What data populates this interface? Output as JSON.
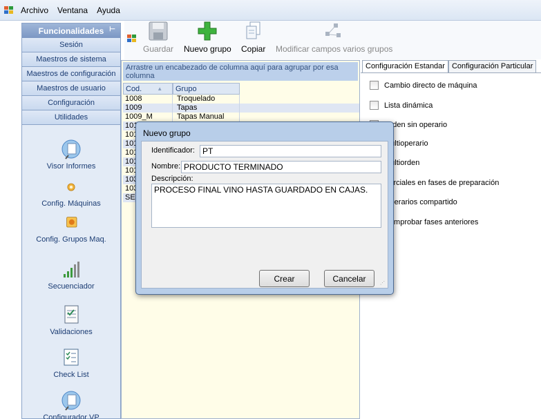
{
  "menu": {
    "items": [
      "Archivo",
      "Ventana",
      "Ayuda"
    ]
  },
  "sidebar": {
    "header": "Funcionalidades",
    "pin": "ᵖ",
    "buttons": [
      "Sesión",
      "Maestros de sistema",
      "Maestros de configuración",
      "Maestros de usuario",
      "Configuración",
      "Utilidades"
    ],
    "tools": [
      "Visor Informes",
      "Config. Máquinas",
      "Config. Grupos Maq.",
      "Secuenciador",
      "Validaciones",
      "Check List",
      "Configurador VP"
    ]
  },
  "toolbar": {
    "save": "Guardar",
    "new_group": "Nuevo grupo",
    "copy": "Copiar",
    "modify": "Modificar campos varios grupos"
  },
  "grid": {
    "group_hint": "Arrastre un encabezado de columna aquí para agrupar por esa columna",
    "columns": [
      "Cod.",
      "Grupo"
    ],
    "rows": [
      [
        "1008",
        "Troquelado"
      ],
      [
        "1009",
        "Tapas"
      ],
      [
        "1009_M",
        "Tapas Manual"
      ],
      [
        "101",
        ""
      ],
      [
        "101",
        ""
      ],
      [
        "101",
        ""
      ],
      [
        "101",
        ""
      ],
      [
        "101",
        ""
      ],
      [
        "101",
        ""
      ],
      [
        "103",
        ""
      ],
      [
        "103",
        ""
      ],
      [
        "SE",
        ""
      ]
    ]
  },
  "tabs": {
    "standard": "Configuración Estandar",
    "particular": "Configuración Particular"
  },
  "options": [
    "Cambio directo de máquina",
    "Lista dinámica",
    "Orden sin operario",
    "Multioperario",
    "Multiorden",
    "Parciales en fases de preparación",
    "Operarios compartido",
    "Comprobar fases anteriores"
  ],
  "dialog": {
    "title": "Nuevo grupo",
    "id_label": "Identificador:",
    "id_value": "PT",
    "name_label": "Nombre:",
    "name_value": "PRODUCTO TERMINADO",
    "desc_label": "Descripción:",
    "desc_value": "PROCESO FINAL VINO HASTA GUARDADO EN CAJAS.",
    "create": "Crear",
    "cancel": "Cancelar"
  }
}
